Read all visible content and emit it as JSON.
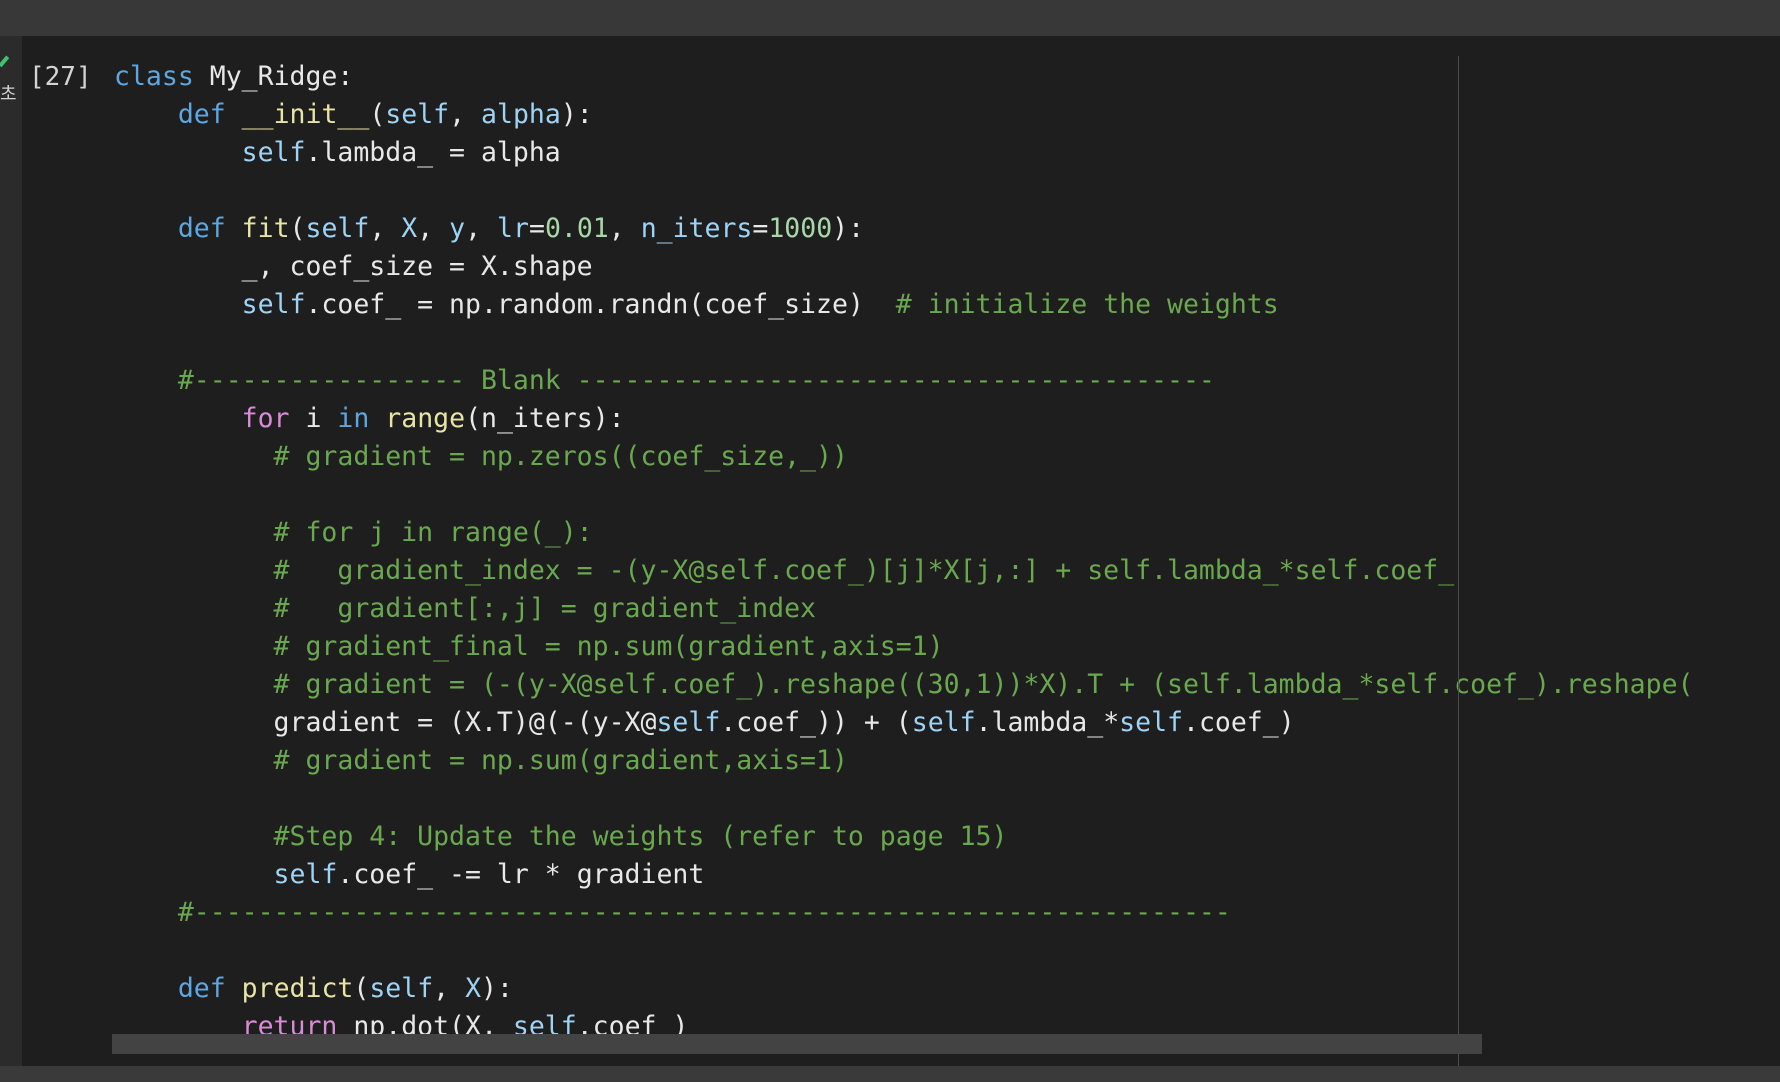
{
  "cell": {
    "execution_count": "[27]",
    "gutter_glyph": "초",
    "code_lines": [
      [
        {
          "t": "class",
          "c": "kw"
        },
        {
          "t": " ",
          "c": "plain"
        },
        {
          "t": "My_Ridge",
          "c": "plain"
        },
        {
          "t": ":",
          "c": "plain"
        }
      ],
      [
        {
          "t": "    ",
          "c": "plain"
        },
        {
          "t": "def",
          "c": "kw"
        },
        {
          "t": " ",
          "c": "plain"
        },
        {
          "t": "__init__",
          "c": "fn"
        },
        {
          "t": "(",
          "c": "plain"
        },
        {
          "t": "self",
          "c": "self"
        },
        {
          "t": ", ",
          "c": "plain"
        },
        {
          "t": "alpha",
          "c": "var"
        },
        {
          "t": "):",
          "c": "plain"
        }
      ],
      [
        {
          "t": "        ",
          "c": "plain"
        },
        {
          "t": "self",
          "c": "self"
        },
        {
          "t": ".lambda_ = alpha",
          "c": "plain"
        }
      ],
      [],
      [
        {
          "t": "    ",
          "c": "plain"
        },
        {
          "t": "def",
          "c": "kw"
        },
        {
          "t": " ",
          "c": "plain"
        },
        {
          "t": "fit",
          "c": "fn"
        },
        {
          "t": "(",
          "c": "plain"
        },
        {
          "t": "self",
          "c": "self"
        },
        {
          "t": ", ",
          "c": "plain"
        },
        {
          "t": "X",
          "c": "var"
        },
        {
          "t": ", ",
          "c": "plain"
        },
        {
          "t": "y",
          "c": "var"
        },
        {
          "t": ", ",
          "c": "plain"
        },
        {
          "t": "lr",
          "c": "var"
        },
        {
          "t": "=",
          "c": "plain"
        },
        {
          "t": "0.01",
          "c": "num"
        },
        {
          "t": ", ",
          "c": "plain"
        },
        {
          "t": "n_iters",
          "c": "var"
        },
        {
          "t": "=",
          "c": "plain"
        },
        {
          "t": "1000",
          "c": "num"
        },
        {
          "t": "):",
          "c": "plain"
        }
      ],
      [
        {
          "t": "        _, coef_size = X.shape",
          "c": "plain"
        }
      ],
      [
        {
          "t": "        ",
          "c": "plain"
        },
        {
          "t": "self",
          "c": "self"
        },
        {
          "t": ".coef_ = np.random.randn(coef_size)  ",
          "c": "plain"
        },
        {
          "t": "# initialize the weights",
          "c": "cmt"
        }
      ],
      [],
      [
        {
          "t": "    ",
          "c": "plain"
        },
        {
          "t": "#----------------- Blank ----------------------------------------",
          "c": "cmt"
        }
      ],
      [
        {
          "t": "        ",
          "c": "plain"
        },
        {
          "t": "for",
          "c": "kw-ctrl"
        },
        {
          "t": " i ",
          "c": "plain"
        },
        {
          "t": "in",
          "c": "kw"
        },
        {
          "t": " ",
          "c": "plain"
        },
        {
          "t": "range",
          "c": "fn"
        },
        {
          "t": "(n_iters):",
          "c": "plain"
        }
      ],
      [
        {
          "t": "          ",
          "c": "plain"
        },
        {
          "t": "# gradient = np.zeros((coef_size,_))",
          "c": "cmt"
        }
      ],
      [],
      [
        {
          "t": "          ",
          "c": "plain"
        },
        {
          "t": "# for j in range(_):",
          "c": "cmt"
        }
      ],
      [
        {
          "t": "          ",
          "c": "plain"
        },
        {
          "t": "#   gradient_index = -(y-X@self.coef_)[j]*X[j,:] + self.lambda_*self.coef_",
          "c": "cmt"
        }
      ],
      [
        {
          "t": "          ",
          "c": "plain"
        },
        {
          "t": "#   gradient[:,j] = gradient_index",
          "c": "cmt"
        }
      ],
      [
        {
          "t": "          ",
          "c": "plain"
        },
        {
          "t": "# gradient_final = np.sum(gradient,axis=1)",
          "c": "cmt"
        }
      ],
      [
        {
          "t": "          ",
          "c": "plain"
        },
        {
          "t": "# gradient = (-(y-X@self.coef_).reshape((30,1))*X).T + (self.lambda_*self.coef_).reshape(",
          "c": "cmt"
        }
      ],
      [
        {
          "t": "          gradient = (X.T)@(-(y-X@",
          "c": "plain"
        },
        {
          "t": "self",
          "c": "self"
        },
        {
          "t": ".coef_)) + (",
          "c": "plain"
        },
        {
          "t": "self",
          "c": "self"
        },
        {
          "t": ".lambda_*",
          "c": "plain"
        },
        {
          "t": "self",
          "c": "self"
        },
        {
          "t": ".coef_)",
          "c": "plain"
        }
      ],
      [
        {
          "t": "          ",
          "c": "plain"
        },
        {
          "t": "# gradient = np.sum(gradient,axis=1)",
          "c": "cmt"
        }
      ],
      [],
      [
        {
          "t": "          ",
          "c": "plain"
        },
        {
          "t": "#Step 4: Update the weights (refer to page 15)",
          "c": "cmt"
        }
      ],
      [
        {
          "t": "          ",
          "c": "plain"
        },
        {
          "t": "self",
          "c": "self"
        },
        {
          "t": ".coef_ -= lr * gradient",
          "c": "plain"
        }
      ],
      [
        {
          "t": "    ",
          "c": "plain"
        },
        {
          "t": "#-----------------------------------------------------------------",
          "c": "cmt"
        }
      ],
      [],
      [
        {
          "t": "    ",
          "c": "plain"
        },
        {
          "t": "def",
          "c": "kw"
        },
        {
          "t": " ",
          "c": "plain"
        },
        {
          "t": "predict",
          "c": "fn"
        },
        {
          "t": "(",
          "c": "plain"
        },
        {
          "t": "self",
          "c": "self"
        },
        {
          "t": ", ",
          "c": "plain"
        },
        {
          "t": "X",
          "c": "var"
        },
        {
          "t": "):",
          "c": "plain"
        }
      ],
      [
        {
          "t": "        ",
          "c": "plain"
        },
        {
          "t": "return",
          "c": "kw-ctrl"
        },
        {
          "t": " np.dot(X, ",
          "c": "plain"
        },
        {
          "t": "self",
          "c": "self"
        },
        {
          "t": ".coef_)",
          "c": "plain"
        }
      ]
    ]
  },
  "colors": {
    "editor_background": "#1e1e1e",
    "keyword": "#5ea6e0",
    "control_keyword": "#d88bd6",
    "function_name": "#e8e4a6",
    "self_and_params": "#9fd3f5",
    "number": "#a6d8a8",
    "comment": "#6aa84f",
    "run_indicator": "#3ec46d"
  }
}
